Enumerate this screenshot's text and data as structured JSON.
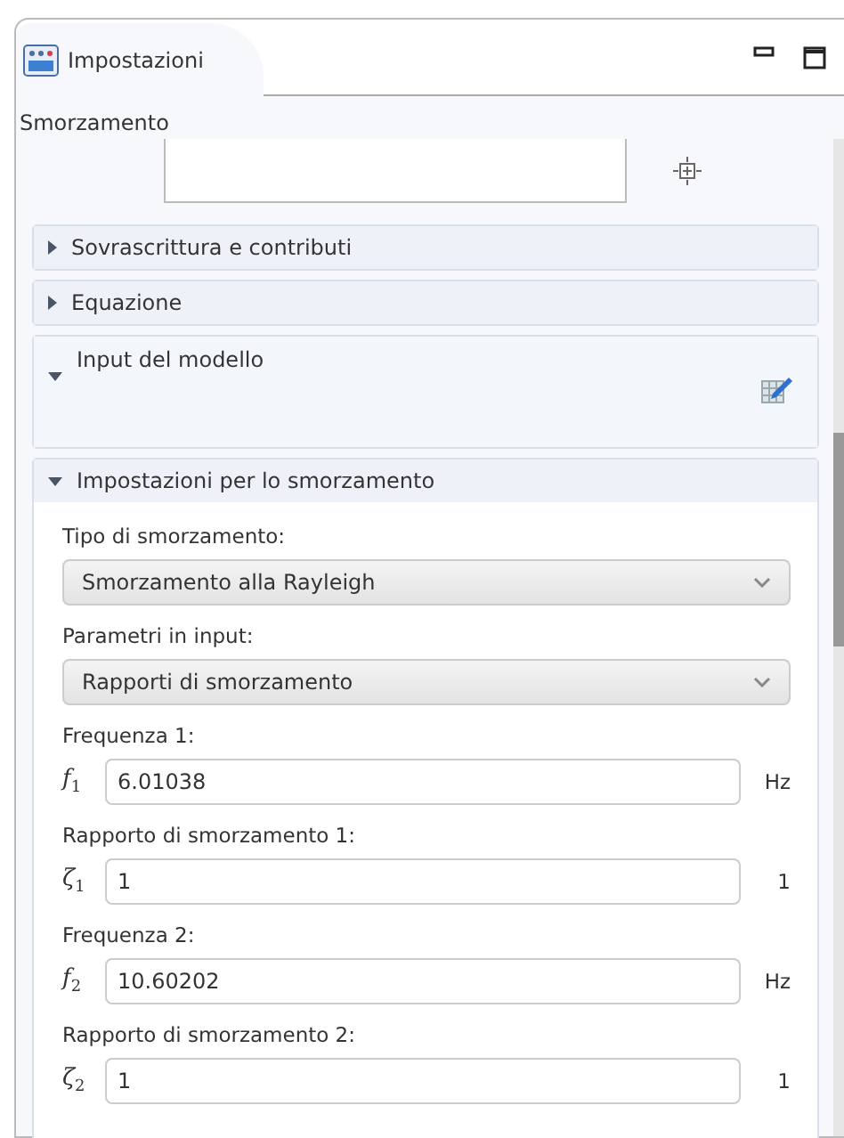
{
  "tab": {
    "title": "Impostazioni",
    "selected": true
  },
  "node_title": "Smorzamento",
  "sections": [
    {
      "kind": "simple",
      "title": "Sovrascrittura e contributi",
      "expanded": false
    },
    {
      "kind": "simple",
      "title": "Equazione",
      "expanded": false
    },
    {
      "kind": "model",
      "title": "Input del modello",
      "expanded": true
    },
    {
      "kind": "form",
      "title": "Impostazioni per lo smorzamento",
      "expanded": true,
      "items": [
        {
          "kind": "select",
          "label": "Tipo di smorzamento:",
          "value": "Smorzamento alla Rayleigh"
        },
        {
          "kind": "select",
          "label": "Parametri in input:",
          "value": "Rapporti di smorzamento"
        },
        {
          "kind": "field",
          "label": "Frequenza 1:",
          "symbol": "*f*$_{1}$",
          "value": "6.01038",
          "unit": "Hz"
        },
        {
          "kind": "field",
          "label": "Rapporto di smorzamento 1:",
          "symbol": "*ζ*$_{1}$",
          "value": "1",
          "unit": "1"
        },
        {
          "kind": "field",
          "label": "Frequenza 2:",
          "symbol": "*f*$_{2}$",
          "value": "10.60202",
          "unit": "Hz"
        },
        {
          "kind": "field",
          "label": "Rapporto di smorzamento 2:",
          "symbol": "*ζ*$_{2}$",
          "value": "1",
          "unit": "1"
        }
      ]
    }
  ]
}
